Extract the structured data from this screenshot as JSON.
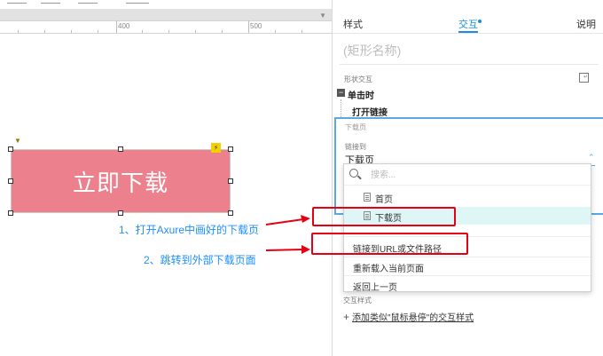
{
  "ruler": {
    "marks": [
      "400",
      "500"
    ]
  },
  "canvas": {
    "button_text": "立即下载",
    "annotation_1": "1、打开Axure中画好的下载页",
    "annotation_2": "2、跳转到外部下载页面"
  },
  "panel": {
    "tabs": [
      {
        "label": "样式",
        "active": false
      },
      {
        "label": "交互",
        "active": true
      },
      {
        "label": "说明",
        "active": false
      }
    ],
    "shape_name_placeholder": "(矩形名称)",
    "section_title": "形状交互",
    "event_label": "单击时",
    "action_label": "打开链接",
    "action_target_note": "下载页",
    "link_to_label": "链接到",
    "link_to_value": "下载页",
    "dropdown": {
      "search_placeholder": "搜索...",
      "pages": [
        {
          "label": "首页",
          "selected": false
        },
        {
          "label": "下载页",
          "selected": true
        }
      ],
      "options": [
        "链接到URL或文件路径",
        "重新载入当前页面",
        "返回上一页"
      ]
    },
    "interaction_styles_title": "交互样式",
    "add_style_label": "添加类似\"鼠标悬停\"的交互样式"
  },
  "colors": {
    "button_fill": "#ec808d",
    "accent": "#1a8ed8",
    "annotation": "#1e90ff",
    "highlight": "#e60012",
    "selected_row": "#dff6f6"
  }
}
